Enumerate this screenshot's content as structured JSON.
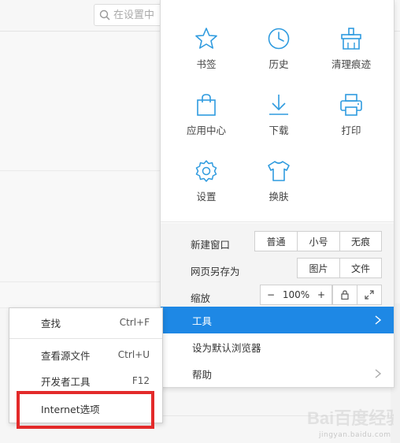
{
  "background": {
    "search_placeholder": "在设置中"
  },
  "menu_grid": [
    {
      "label": "书签",
      "icon": "star-icon"
    },
    {
      "label": "历史",
      "icon": "clock-icon"
    },
    {
      "label": "清理痕迹",
      "icon": "broom-icon"
    },
    {
      "label": "应用中心",
      "icon": "bag-icon"
    },
    {
      "label": "下载",
      "icon": "download-icon"
    },
    {
      "label": "打印",
      "icon": "printer-icon"
    },
    {
      "label": "设置",
      "icon": "gear-icon"
    },
    {
      "label": "换肤",
      "icon": "shirt-icon"
    }
  ],
  "controls": {
    "new_window": {
      "label": "新建窗口",
      "options": [
        "普通",
        "小号",
        "无痕"
      ]
    },
    "save_as": {
      "label": "网页另存为",
      "options": [
        "图片",
        "文件"
      ]
    },
    "zoom": {
      "label": "缩放",
      "minus": "−",
      "value": "100%",
      "plus": "+"
    }
  },
  "menu_items": [
    {
      "label": "工具",
      "active": true,
      "has_submenu": true
    },
    {
      "label": "设为默认浏览器",
      "active": false,
      "has_submenu": false
    },
    {
      "label": "帮助",
      "active": false,
      "has_submenu": true
    }
  ],
  "submenu": [
    {
      "label": "查找",
      "shortcut": "Ctrl+F"
    },
    {
      "label": "查看源文件",
      "shortcut": "Ctrl+U"
    },
    {
      "label": "开发者工具",
      "shortcut": "F12"
    },
    {
      "label": "Internet选项",
      "shortcut": ""
    }
  ],
  "watermark": {
    "logo_text": "Bai百度经验",
    "url_text": "jingyan.baidu.com"
  },
  "colors": {
    "accent": "#1e88e5",
    "icon": "#2f9bdf",
    "highlight": "#e32a2a"
  }
}
